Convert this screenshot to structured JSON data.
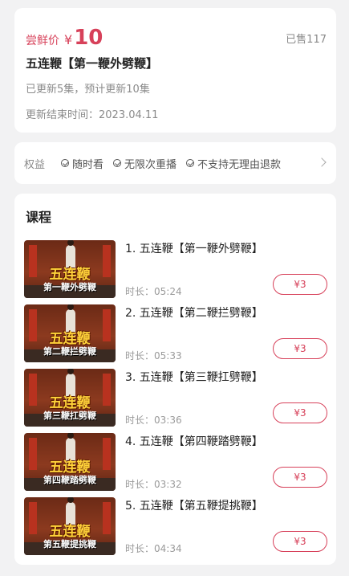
{
  "header": {
    "price_label": "尝鲜价",
    "currency": "¥",
    "price": "10",
    "sold": "已售117",
    "title": "五连鞭【第一鞭外劈鞭】",
    "update_status": "已更新5集，预计更新10集",
    "update_end": "更新结束时间：2023.04.11"
  },
  "benefits": {
    "label": "权益",
    "items": [
      "随时看",
      "无限次重播",
      "不支持无理由退款"
    ]
  },
  "course": {
    "section_title": "课程",
    "lessons": [
      {
        "title": "1. 五连鞭【第一鞭外劈鞭】",
        "duration": "时长：05:24",
        "price": "¥3",
        "thumb_title": "五连鞭",
        "thumb_sub": "第一鞭外劈鞭"
      },
      {
        "title": "2. 五连鞭【第二鞭拦劈鞭】",
        "duration": "时长：05:33",
        "price": "¥3",
        "thumb_title": "五连鞭",
        "thumb_sub": "第二鞭拦劈鞭"
      },
      {
        "title": "3. 五连鞭【第三鞭扛劈鞭】",
        "duration": "时长：03:36",
        "price": "¥3",
        "thumb_title": "五连鞭",
        "thumb_sub": "第三鞭扛劈鞭"
      },
      {
        "title": "4. 五连鞭【第四鞭踏劈鞭】",
        "duration": "时长：03:32",
        "price": "¥3",
        "thumb_title": "五连鞭",
        "thumb_sub": "第四鞭踏劈鞭"
      },
      {
        "title": "5. 五连鞭【第五鞭提挑鞭】",
        "duration": "时长：04:34",
        "price": "¥3",
        "thumb_title": "五连鞭",
        "thumb_sub": "第五鞭提挑鞭"
      }
    ]
  },
  "colors": {
    "accent": "#d7415a",
    "background": "#f2f2f3",
    "card": "#ffffff"
  },
  "icons": {
    "benefit": "check-circle-icon",
    "more": "chevron-right-icon"
  }
}
